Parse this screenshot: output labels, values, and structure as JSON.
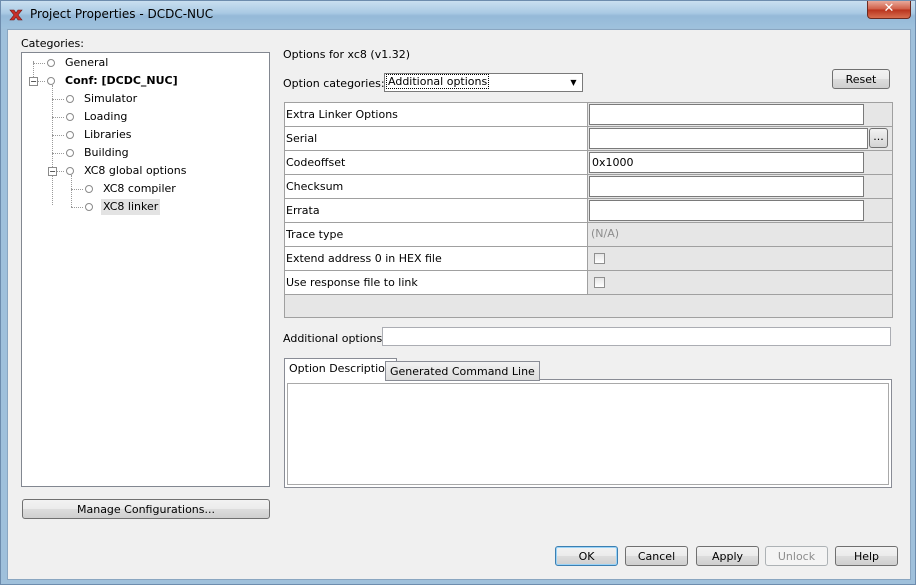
{
  "window": {
    "title": "Project Properties - DCDC-NUC",
    "close_glyph": "✕",
    "accent": "#9fc0db"
  },
  "categories": {
    "label": "Categories:",
    "items": [
      {
        "label": "General"
      },
      {
        "label": "Conf: [DCDC_NUC]"
      },
      {
        "label": "Simulator"
      },
      {
        "label": "Loading"
      },
      {
        "label": "Libraries"
      },
      {
        "label": "Building"
      },
      {
        "label": "XC8 global options"
      },
      {
        "label": "XC8 compiler"
      },
      {
        "label": "XC8 linker"
      }
    ],
    "selected": "XC8 linker",
    "manage_button": "Manage Configurations..."
  },
  "options": {
    "header": "Options for xc8 (v1.32)",
    "category_label": "Option categories:",
    "category_value": "Additional options",
    "reset_button": "Reset",
    "rows": [
      {
        "name": "Extra Linker Options",
        "value": ""
      },
      {
        "name": "Serial",
        "value": "",
        "browse": "..."
      },
      {
        "name": "Codeoffset",
        "value": "0x1000"
      },
      {
        "name": "Checksum",
        "value": ""
      },
      {
        "name": "Errata",
        "value": ""
      },
      {
        "name": "Trace type",
        "value": "(N/A)"
      },
      {
        "name": "Extend address 0 in HEX file",
        "checked": false
      },
      {
        "name": "Use response file to link",
        "checked": false
      }
    ],
    "additional_label": "Additional options:",
    "additional_value": ""
  },
  "tabs": [
    {
      "label": "Option Description",
      "active": true
    },
    {
      "label": "Generated Command Line",
      "active": false
    }
  ],
  "footer": {
    "ok": "OK",
    "cancel": "Cancel",
    "apply": "Apply",
    "unlock": "Unlock",
    "help": "Help"
  }
}
